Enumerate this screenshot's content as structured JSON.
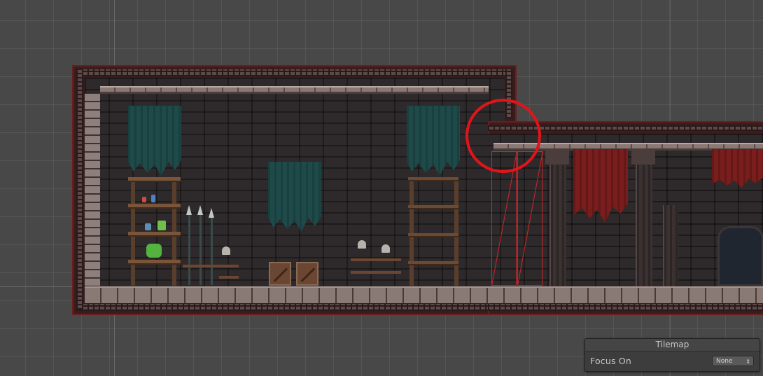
{
  "tilemap_panel": {
    "title": "Tilemap",
    "focus_label": "Focus On",
    "focus_value": "None",
    "arrow_icon": "up-down-chevron-icon"
  },
  "scene": {
    "highlight_color": "#e0151a",
    "collider_color": "#d0262b"
  }
}
